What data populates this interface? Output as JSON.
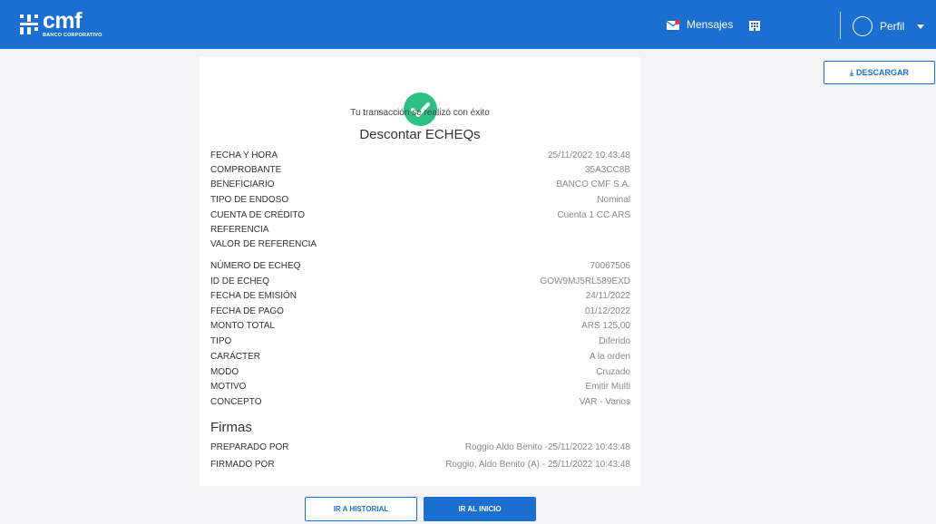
{
  "brand": {
    "name": "cmf",
    "tagline": "BANCO CORPORATIVO"
  },
  "nav": {
    "messages_label": "Mensajes",
    "profile_label": "Perfil"
  },
  "actions": {
    "download_label": "DESCARGAR",
    "history_label": "IR A HISTORIAL",
    "home_label": "IR AL INICIO"
  },
  "colors": {
    "primary": "#1a6fd1",
    "success": "#2bc084",
    "page_bg": "#f4f4f6"
  },
  "receipt": {
    "success_message": "Tu transacción se realizó con éxito",
    "title": "Descontar ECHEQs",
    "details": [
      {
        "label": "FECHA Y HORA",
        "value": "25/11/2022 10:43:48"
      },
      {
        "label": "COMPROBANTE",
        "value": "35A3CC8B"
      },
      {
        "label": "BENEFICIARIO",
        "value": "BANCO CMF S.A."
      },
      {
        "label": "TIPO DE ENDOSO",
        "value": "Nominal"
      },
      {
        "label": "CUENTA DE CRÉDITO",
        "value": "Cuenta 1 CC ARS"
      },
      {
        "label": "REFERENCIA",
        "value": ""
      },
      {
        "label": "VALOR DE REFERENCIA",
        "value": ""
      }
    ],
    "echeq": [
      {
        "label": "NÚMERO DE ECHEQ",
        "value": "70067506"
      },
      {
        "label": "ID DE ECHEQ",
        "value": "GOW9MJ5RL589EXD"
      },
      {
        "label": "FECHA DE EMISIÓN",
        "value": "24/11/2022"
      },
      {
        "label": "FECHA DE PAGO",
        "value": "01/12/2022"
      },
      {
        "label": "MONTO TOTAL",
        "value": "ARS 125,00"
      },
      {
        "label": "TIPO",
        "value": "Diferido"
      },
      {
        "label": "CARÁCTER",
        "value": "A la orden"
      },
      {
        "label": "MODO",
        "value": "Cruzado"
      },
      {
        "label": "MOTIVO",
        "value": "Emitir Multi"
      },
      {
        "label": "CONCEPTO",
        "value": "VAR - Varios"
      }
    ],
    "signatures_title": "Firmas",
    "signatures": [
      {
        "label": "PREPARADO POR",
        "value": "Roggio Aldo Benito -25/11/2022 10:43:48"
      },
      {
        "label": "FIRMADO POR",
        "value": "Roggio, Aldo Benito (A) - 25/11/2022 10:43:48"
      }
    ]
  },
  "icons": [
    "cmf-logo-icon",
    "mail-icon",
    "building-icon",
    "avatar-icon",
    "caret-down-icon",
    "download-icon",
    "check-circle-icon"
  ]
}
